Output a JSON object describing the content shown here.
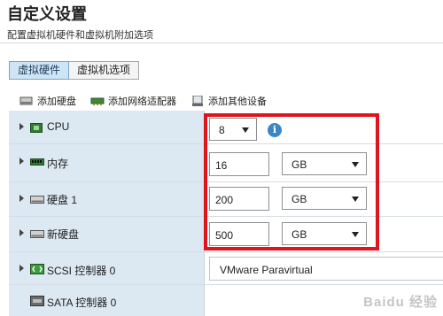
{
  "header": {
    "title": "自定义设置",
    "subtitle": "配置虚拟机硬件和虚拟机附加选项"
  },
  "tabs": [
    {
      "label": "虚拟硬件",
      "active": true
    },
    {
      "label": "虚拟机选项",
      "active": false
    }
  ],
  "toolbar": {
    "add_disk": "添加硬盘",
    "add_nic": "添加网络适配器",
    "add_other": "添加其他设备"
  },
  "hardware": {
    "cpu": {
      "label": "CPU",
      "value": "8",
      "icon": "cpu-chip-icon"
    },
    "memory": {
      "label": "内存",
      "value": "16",
      "unit": "GB",
      "icon": "memory-module-icon"
    },
    "disk1": {
      "label": "硬盘 1",
      "value": "200",
      "unit": "GB",
      "icon": "hard-disk-icon"
    },
    "newdisk": {
      "label": "新硬盘",
      "value": "500",
      "unit": "GB",
      "icon": "hard-disk-icon"
    },
    "scsi": {
      "label": "SCSI 控制器 0",
      "value": "VMware Paravirtual",
      "icon": "scsi-controller-icon"
    },
    "sata": {
      "label": "SATA 控制器 0",
      "icon": "sata-controller-icon"
    }
  },
  "colors": {
    "highlight": "#e0141c",
    "active_tab": "#cfe4f4",
    "label_column": "#dce8f2",
    "info_icon": "#3a86c8"
  },
  "watermark": "Baidu 经验"
}
